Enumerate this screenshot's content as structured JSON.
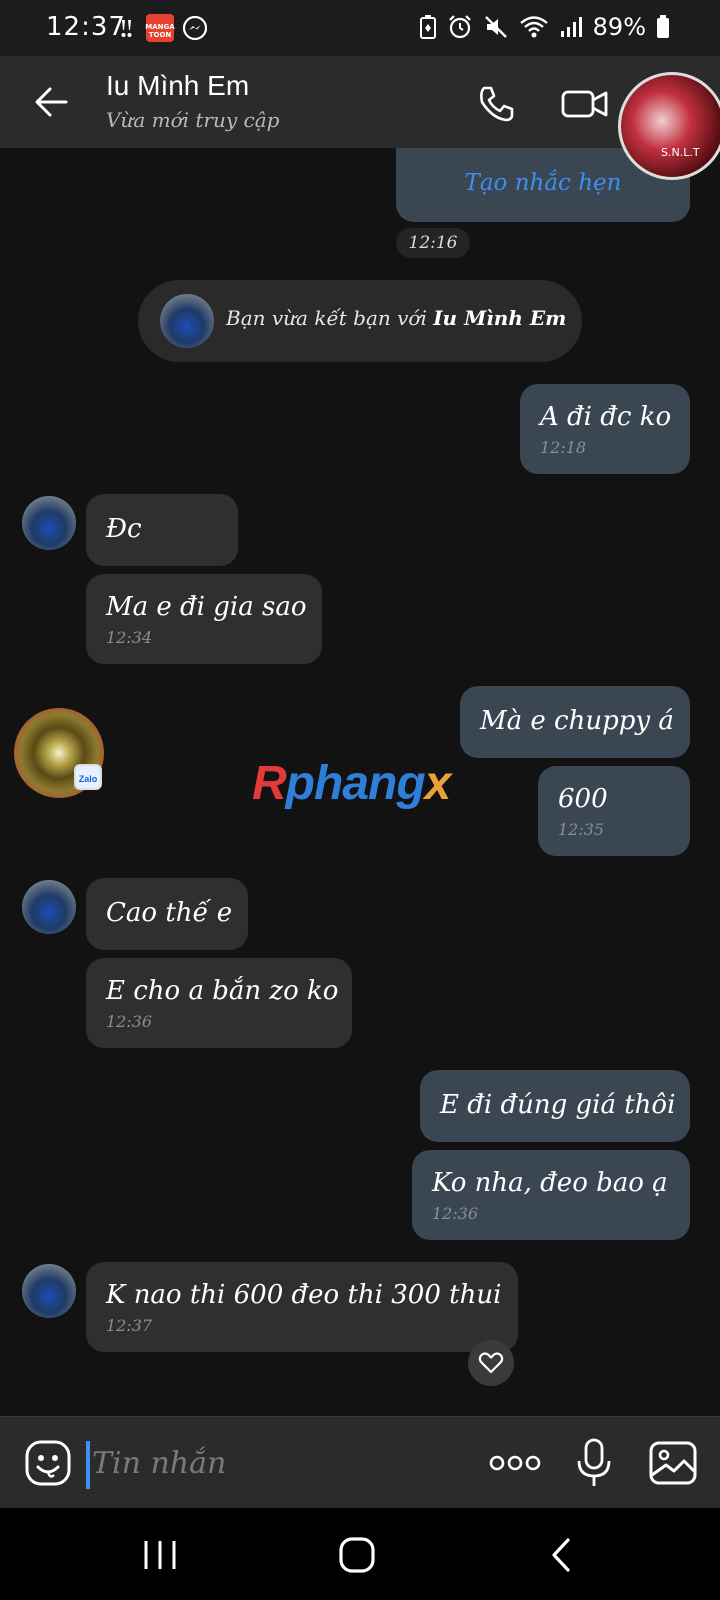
{
  "status_bar": {
    "time": "12:37",
    "manga_icon_label": "MANGA TOON",
    "battery": "89%",
    "icons": [
      "notification-icon",
      "mangatoon-icon",
      "messenger-icon",
      "battery-saver-icon",
      "alarm-icon",
      "mute-icon",
      "wifi-icon",
      "signal-icon",
      "battery-icon"
    ]
  },
  "header": {
    "name": "Iu Mình Em",
    "status": "Vừa mới truy cập",
    "avatar_text": "S.N.L.T"
  },
  "reminder": {
    "link": "Tạo nhắc hẹn",
    "time": "12:16"
  },
  "friend_notice": {
    "prefix": "Bạn vừa kết bạn với",
    "name": "Iu Mình Em"
  },
  "messages": [
    {
      "side": "sent",
      "text": "A đi đc ko",
      "time": "12:18"
    },
    {
      "side": "recv",
      "text": "Đc"
    },
    {
      "side": "recv",
      "text": "Ma e đi gia sao",
      "time": "12:34"
    },
    {
      "side": "sent",
      "text": "Mà e chuppy á"
    },
    {
      "side": "sent",
      "text": "600",
      "time": "12:35"
    },
    {
      "side": "recv",
      "text": "Cao thế e"
    },
    {
      "side": "recv",
      "text": "E cho a bắn zo ko",
      "time": "12:36"
    },
    {
      "side": "sent",
      "text": "E đi đúng giá thôi"
    },
    {
      "side": "sent",
      "text": "Ko nha, đeo bao ạ",
      "time": "12:36"
    },
    {
      "side": "recv",
      "text": "K nao thi 600 đeo thi 300 thui",
      "time": "12:37"
    }
  ],
  "badge": {
    "zalo": "Zalo"
  },
  "watermark": {
    "part1": "R",
    "part2": "phang",
    "part3": "x"
  },
  "composer": {
    "placeholder": "Tin nhắn"
  },
  "colors": {
    "background": "#121212",
    "sent_bubble": "#3b4653",
    "recv_bubble": "#2f2f2f",
    "accent": "#3d8ef5"
  }
}
